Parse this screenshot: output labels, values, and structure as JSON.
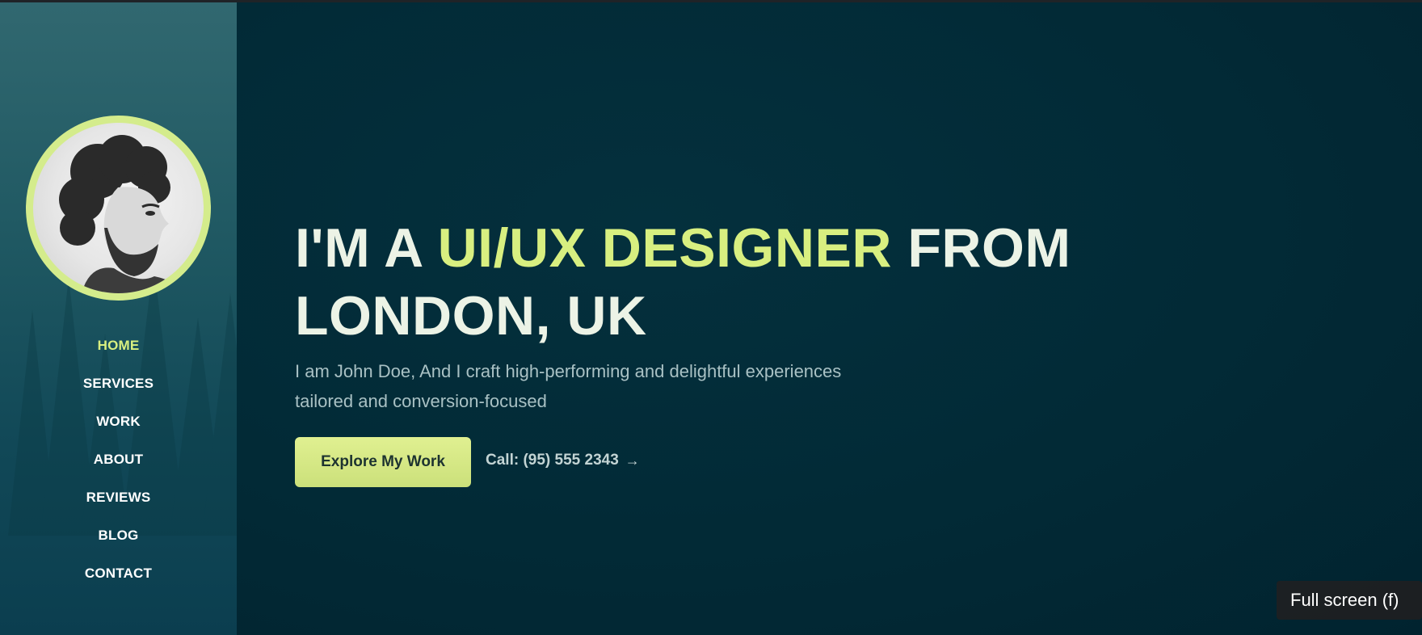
{
  "sidebar": {
    "avatar_alt": "John Doe portrait",
    "nav": [
      {
        "label": "HOME",
        "active": true
      },
      {
        "label": "SERVICES",
        "active": false
      },
      {
        "label": "WORK",
        "active": false
      },
      {
        "label": "ABOUT",
        "active": false
      },
      {
        "label": "REVIEWS",
        "active": false
      },
      {
        "label": "BLOG",
        "active": false
      },
      {
        "label": "CONTACT",
        "active": false
      }
    ]
  },
  "hero": {
    "headline_prefix": "I'M A ",
    "headline_accent": "UI/UX DESIGNER",
    "headline_suffix": " FROM",
    "headline_line2": "LONDON, UK",
    "subtitle_line1": "I am John Doe, And I craft high-performing and delightful experiences",
    "subtitle_line2": "tailored and conversion-focused",
    "cta_label": "Explore My Work",
    "call_label": "Call: (95) 555 2343",
    "call_arrow": "→"
  },
  "player": {
    "tooltip": "Full screen (f)"
  },
  "colors": {
    "accent": "#d8ef80",
    "background": "#022a36",
    "sidebar": "#1f5862",
    "text": "#ecf3e6"
  },
  "icons": {
    "call_arrow": "arrow-right-icon",
    "carousel_dot": "circle-dot-icon"
  }
}
